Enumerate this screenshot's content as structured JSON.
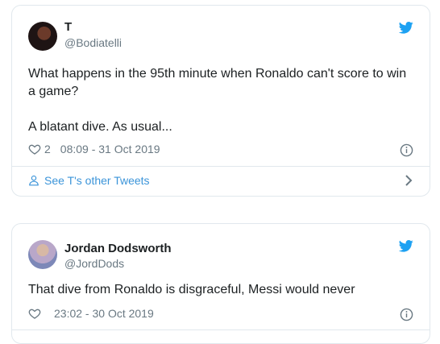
{
  "tweets": [
    {
      "name": "T",
      "handle": "@Bodiatelli",
      "text_line1": "What happens in the 95th minute when Ronaldo can't score to win a game?",
      "text_line2": "A blatant dive. As usual...",
      "likes": "2",
      "timestamp": "08:09 - 31 Oct 2019",
      "footer_link": "See T's other Tweets"
    },
    {
      "name": "Jordan Dodsworth",
      "handle": "@JordDods",
      "text_line1": "That dive from Ronaldo is disgraceful, Messi would never",
      "likes": "",
      "timestamp": "23:02 - 30 Oct 2019"
    }
  ],
  "icons": {
    "brand": "twitter-bird-icon",
    "like": "heart-icon",
    "info": "info-icon",
    "profile": "person-icon",
    "more": "chevron-right-icon"
  },
  "colors": {
    "twitter_blue": "#1da1f2",
    "link_blue": "#3b94d9",
    "meta_gray": "#697882",
    "border": "#e1e8ed"
  }
}
